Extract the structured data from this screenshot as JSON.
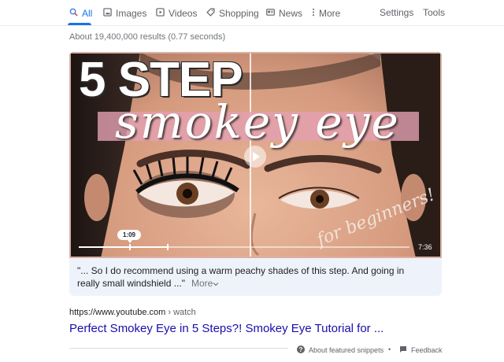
{
  "nav": {
    "tabs": [
      {
        "label": "All",
        "icon": "search-icon",
        "active": true
      },
      {
        "label": "Images",
        "icon": "image-icon"
      },
      {
        "label": "Videos",
        "icon": "video-icon"
      },
      {
        "label": "Shopping",
        "icon": "tag-icon"
      },
      {
        "label": "News",
        "icon": "news-icon"
      },
      {
        "label": "More",
        "icon": "more-vert-icon"
      }
    ],
    "settings": "Settings",
    "tools": "Tools"
  },
  "stats": "About 19,400,000 results (0.77 seconds)",
  "video": {
    "title_main": "5 STEP",
    "title_script": "smokey eye",
    "subtitle_script": "for beginners!",
    "timestamp": "1:09",
    "duration": "7:36",
    "progress_fraction": 0.27
  },
  "snippet": {
    "text": "\"... So I do recommend using a warm peachy shades of this step. And going in really small windshield ...\"",
    "more_label": "More"
  },
  "result": {
    "cite_domain": "https://www.youtube.com",
    "cite_sep": " › ",
    "cite_path": "watch",
    "title": "Perfect Smokey Eye in 5 Steps?! Smokey Eye Tutorial for ..."
  },
  "footer": {
    "about": "About featured snippets",
    "dot": "•",
    "feedback": "Feedback"
  },
  "colors": {
    "accent": "#1a73e8",
    "link": "#1a0dab",
    "snippet_bg": "#eef3fb"
  }
}
